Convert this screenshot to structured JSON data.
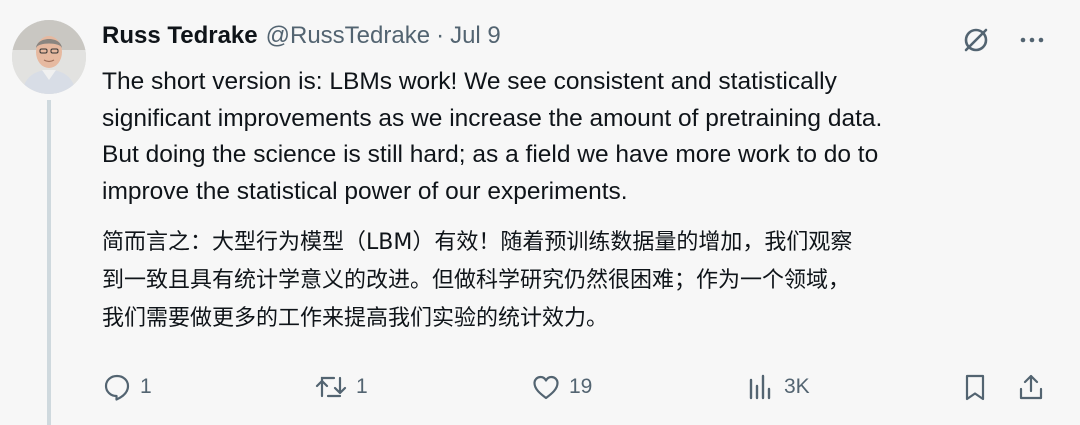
{
  "author": {
    "name": "Russ Tedrake",
    "handle": "@RussTedrake",
    "separator": "·",
    "date": "Jul 9"
  },
  "body": {
    "english": "The short version is: LBMs work! We see consistent and statistically\nsignificant improvements as we increase the amount of pretraining data.\nBut doing the science is still hard; as a field we have more work to do to\nimprove the statistical power of our experiments.",
    "chinese": "简而言之：大型行为模型（LBM）有效！随着预训练数据量的增加，我们观察\n到一致且具有统计学意义的改进。但做科学研究仍然很困难；作为一个领域，\n我们需要做更多的工作来提高我们实验的统计效力。"
  },
  "top_icons": [
    "grok-icon",
    "more-icon"
  ],
  "actions": {
    "reply": {
      "count": "1",
      "icon": "reply-icon"
    },
    "retweet": {
      "count": "1",
      "icon": "retweet-icon"
    },
    "like": {
      "count": "19",
      "icon": "heart-icon"
    },
    "views": {
      "count": "3K",
      "icon": "views-icon"
    },
    "bookmark": {
      "icon": "bookmark-icon"
    },
    "share": {
      "icon": "share-icon"
    }
  },
  "colors": {
    "background": "#f7f7f7",
    "text": "#0f1419",
    "secondary": "#536471",
    "thread_line": "#cfd9de"
  }
}
